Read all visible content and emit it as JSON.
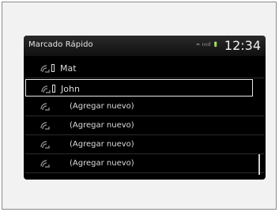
{
  "header": {
    "title": "Marcado Rápido",
    "phone_status": "≈ ııııl 🔋",
    "clock": "12:34"
  },
  "entries": [
    {
      "label": "Mat",
      "icon": "speed-dial-icon",
      "handset": true,
      "selected": false
    },
    {
      "label": "John",
      "icon": "speed-dial-icon",
      "handset": true,
      "selected": true
    },
    {
      "label": "(Agregar nuevo)",
      "icon": "speed-dial-icon",
      "handset": false,
      "selected": false
    },
    {
      "label": "(Agregar nuevo)",
      "icon": "speed-dial-icon",
      "handset": false,
      "selected": false
    },
    {
      "label": "(Agregar nuevo)",
      "icon": "speed-dial-icon",
      "handset": false,
      "selected": false
    },
    {
      "label": "(Agregar nuevo)",
      "icon": "speed-dial-icon",
      "handset": false,
      "selected": false
    }
  ]
}
